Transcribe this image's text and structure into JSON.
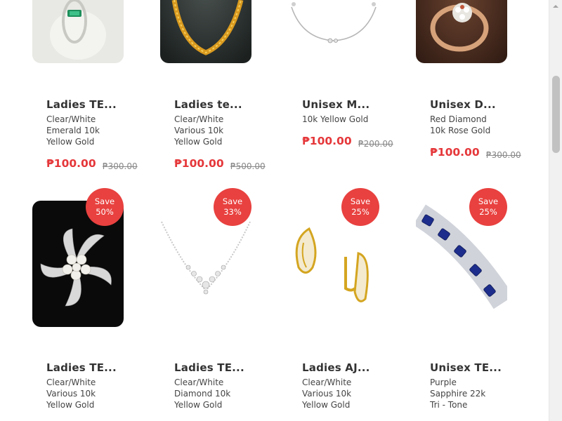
{
  "products": {
    "row1": [
      {
        "title": "Ladies TE...",
        "desc": [
          "Clear/White",
          "Emerald 10k",
          "Yellow Gold"
        ],
        "price": "₱100.00",
        "old_price": "₱300.00",
        "image": "emerald-ring-image"
      },
      {
        "title": "Ladies te...",
        "desc": [
          "Clear/White",
          "Various 10k",
          "Yellow Gold"
        ],
        "price": "₱100.00",
        "old_price": "₱500.00",
        "image": "gold-chain-image"
      },
      {
        "title": "Unisex M...",
        "desc": [
          "10k Yellow Gold"
        ],
        "price": "₱100.00",
        "old_price": "₱200.00",
        "image": "silver-bracelet-image"
      },
      {
        "title": "Unisex D...",
        "desc": [
          "Red Diamond",
          "10k Rose Gold"
        ],
        "price": "₱100.00",
        "old_price": "₱300.00",
        "image": "diamond-ring-image"
      }
    ],
    "row2": [
      {
        "title": "Ladies TE...",
        "desc": [
          "Clear/White",
          "Various 10k",
          "Yellow Gold"
        ],
        "badge": [
          "Save",
          "50%"
        ],
        "image": "pearl-brooch-image"
      },
      {
        "title": "Ladies TE...",
        "desc": [
          "Clear/White",
          "Diamond 10k",
          "Yellow Gold"
        ],
        "badge": [
          "Save",
          "33%"
        ],
        "image": "diamond-necklace-image"
      },
      {
        "title": "Ladies AJ...",
        "desc": [
          "Clear/White",
          "Various 10k",
          "Yellow Gold"
        ],
        "badge": [
          "Save",
          "25%"
        ],
        "image": "gold-earrings-image"
      },
      {
        "title": "Unisex TE...",
        "desc": [
          "Purple",
          "Sapphire 22k",
          "Tri - Tone"
        ],
        "badge": [
          "Save",
          "25%"
        ],
        "image": "sapphire-bracelet-image"
      }
    ]
  },
  "colors": {
    "accent": "#e5373a",
    "badge": "#e8413f"
  }
}
